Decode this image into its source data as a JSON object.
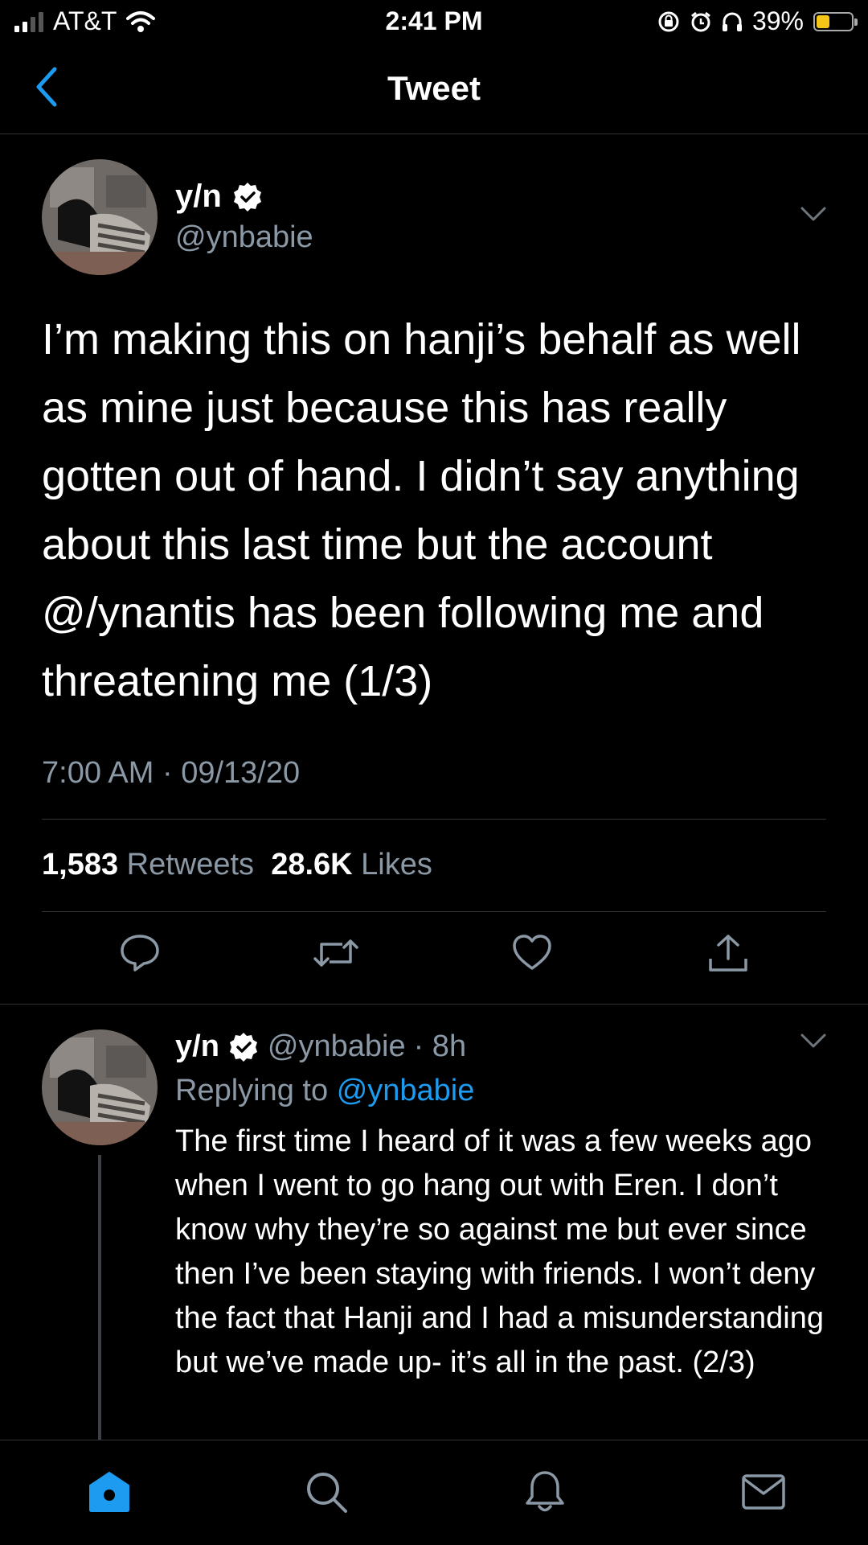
{
  "status_bar": {
    "carrier": "AT&T",
    "time": "2:41 PM",
    "battery": "39%",
    "battery_level": 0.39
  },
  "nav": {
    "title": "Tweet"
  },
  "tweet": {
    "display_name": "y/n",
    "handle": "@ynbabie",
    "text": "I’m making this on hanji’s behalf as well as mine just because this has really gotten out of hand. I didn’t say anything about this last time but the account @/ynantis has been following me and threatening me (1/3)",
    "timestamp": "7:00 AM · 09/13/20",
    "retweet_count": "1,583",
    "retweet_label": "Retweets",
    "like_count": "28.6K",
    "like_label": "Likes"
  },
  "reply": {
    "display_name": "y/n",
    "handle": "@ynbabie",
    "time": "· 8h",
    "replying_prefix": "Replying to",
    "replying_to": "@ynbabie",
    "text": "The first time I heard of it was a few weeks ago when I went to go hang out with Eren. I don’t know why they’re so against me but ever since then I’ve been staying with friends. I won’t deny the fact that Hanji and I had a misunderstanding but we’ve made up- it’s all in the past. (2/3)"
  },
  "icons": {
    "back": "chevron-left-icon",
    "verified": "verified-badge-icon",
    "more": "chevron-down-icon",
    "reply": "comment-icon",
    "retweet": "retweet-icon",
    "like": "heart-icon",
    "share": "share-icon",
    "tabs": [
      "home-icon",
      "search-icon",
      "bell-icon",
      "mail-icon"
    ]
  },
  "colors": {
    "accent": "#1d9bf0",
    "secondary_text": "#8b98a5",
    "background": "#000000"
  }
}
